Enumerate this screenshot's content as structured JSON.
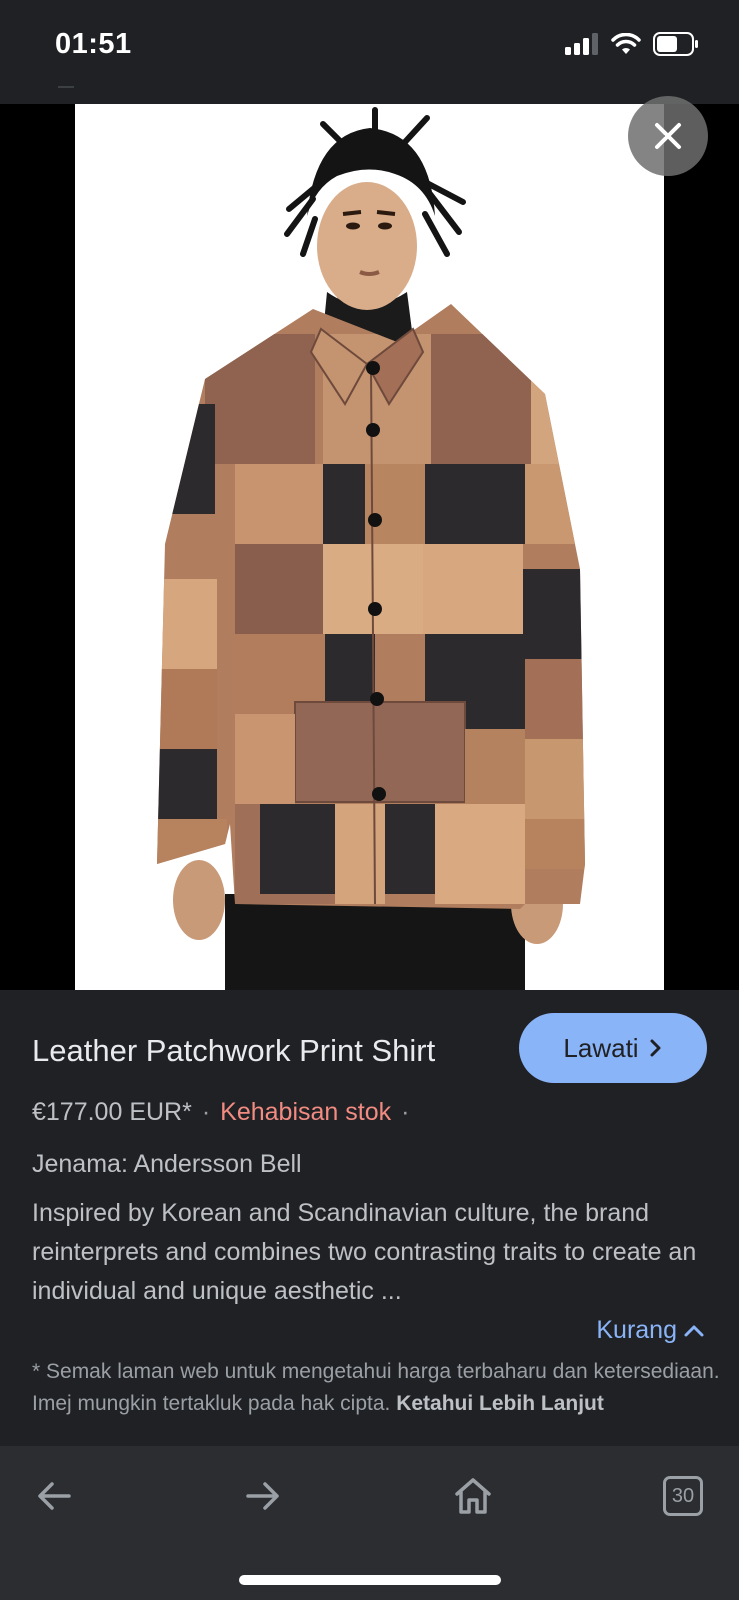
{
  "status_bar": {
    "time": "01:51",
    "icons": [
      "signal-icon",
      "wifi-icon",
      "battery-icon"
    ]
  },
  "viewer": {
    "image_alt": "Model wearing leather patchwork shirt",
    "close_icon": "close-icon"
  },
  "product": {
    "title": "Leather Patchwork Print Shirt",
    "visit_label": "Lawati",
    "price": "€177.00 EUR*",
    "separator": "·",
    "stock_status": "Kehabisan stok",
    "brand_line": "Jenama: Andersson Bell",
    "description": "Inspired by Korean and Scandinavian culture, the brand reinterprets and combines two contrasting traits to create an individual and unique aesthetic ...",
    "less_label": "Kurang",
    "disclaimer": "* Semak laman web untuk mengetahui harga terbaharu dan ketersediaan. Imej mungkin tertakluk pada hak cipta.",
    "learn_more": "Ketahui Lebih Lanjut"
  },
  "toolbar": {
    "back_icon": "back-arrow-icon",
    "forward_icon": "forward-arrow-icon",
    "home_icon": "home-icon",
    "tab_count": "30"
  },
  "colors": {
    "background": "#202124",
    "accent": "#8ab4f8",
    "stock_red": "#f28b82",
    "toolbar": "#2b2d30"
  }
}
